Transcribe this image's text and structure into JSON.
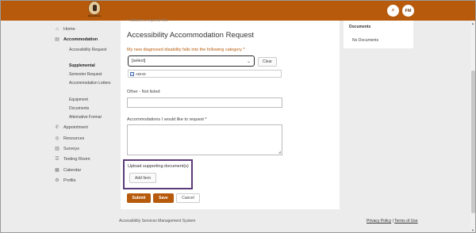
{
  "colors": {
    "brand": "#b75a0c",
    "highlight_border": "#5b3b7a"
  },
  "header": {
    "logo_caption": "Robert Morris",
    "search_icon": "search-icon",
    "avatar_initials": "FM"
  },
  "sidebar": {
    "items": [
      {
        "label": "Home",
        "icon": "home-icon",
        "glyph": "⌂"
      },
      {
        "label": "Accommodation",
        "icon": "accommodation-icon",
        "glyph": "▤"
      },
      {
        "label": "Appointment",
        "icon": "phone-icon",
        "glyph": "✆"
      },
      {
        "label": "Resources",
        "icon": "resources-icon",
        "glyph": "◎"
      },
      {
        "label": "Surveys",
        "icon": "surveys-icon",
        "glyph": "▥"
      },
      {
        "label": "Testing Room",
        "icon": "testing-room-icon",
        "glyph": "☰"
      },
      {
        "label": "Calendar",
        "icon": "calendar-icon",
        "glyph": "▦"
      },
      {
        "label": "Profile",
        "icon": "gear-icon",
        "glyph": "⚙"
      }
    ],
    "sub_items": [
      {
        "label": "Accessibility Request"
      },
      {
        "label": "Supplemental"
      },
      {
        "label": "Semester Request"
      },
      {
        "label": "Accommodation Letters"
      },
      {
        "label": "Equipment"
      },
      {
        "label": "Documents"
      },
      {
        "label": "Alternative Format"
      }
    ]
  },
  "main": {
    "required_note": "* indicates a required field",
    "title": "Accessibility Accommodation Request",
    "disability_label": "My new diagnosed disability falls into the following category *",
    "select_value": "[select]",
    "clear_label": "Clear",
    "dropdown_option": "ADHD",
    "other_label": "Other - Not listed",
    "accommodations_label": "Accommodations I would like to request *",
    "upload_label": "Upload supporting document(s)",
    "add_item_label": "Add Item",
    "submit_label": "Submit",
    "save_label": "Save",
    "cancel_label": "Cancel"
  },
  "documents": {
    "title": "Documents",
    "empty_text": "No Documents"
  },
  "footer": {
    "system_name": "Accessibility Services Management System",
    "privacy_label": "Privacy Policy",
    "separator": "|",
    "terms_label": "Terms of Use"
  }
}
